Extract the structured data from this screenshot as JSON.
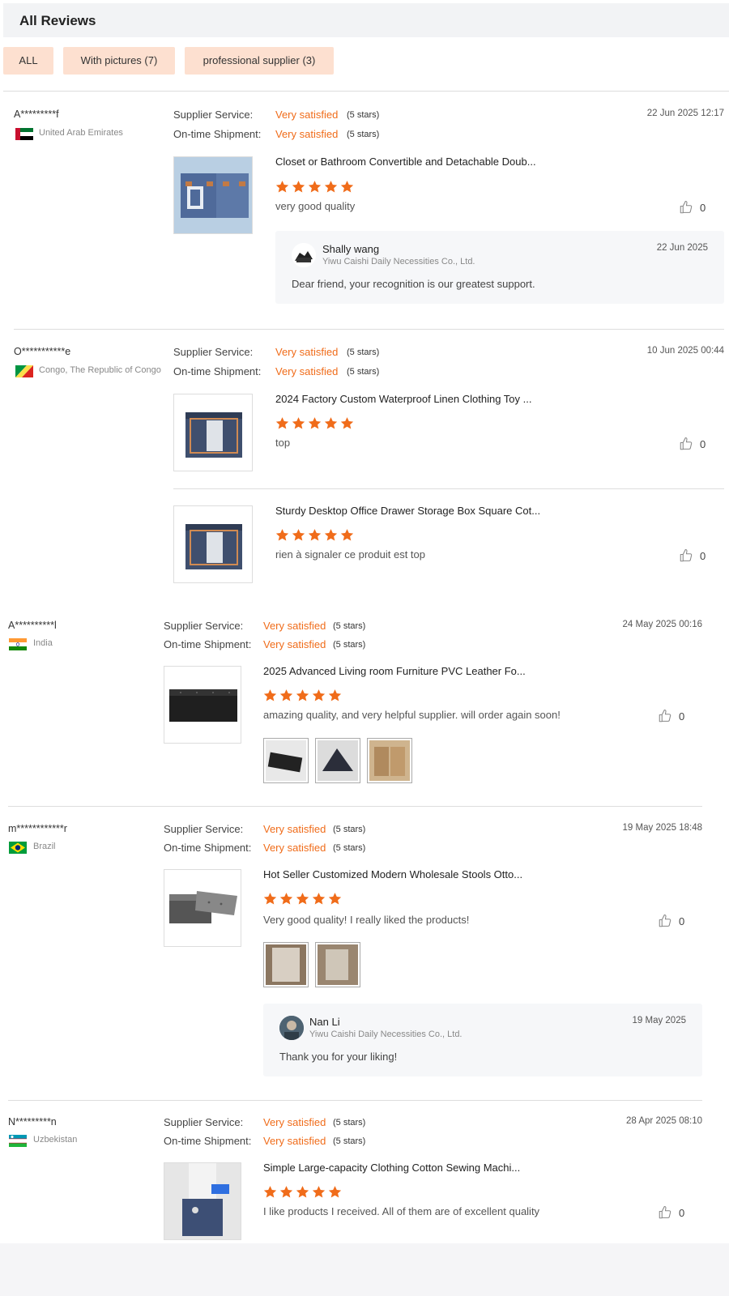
{
  "header": {
    "title": "All Reviews"
  },
  "filters": [
    {
      "label": "ALL"
    },
    {
      "label": "With pictures (7)"
    },
    {
      "label": "professional supplier (3)"
    }
  ],
  "labels": {
    "supplier_service": "Supplier Service:",
    "ontime_shipment": "On-time Shipment:"
  },
  "colors": {
    "accent": "#f06c1a",
    "filter_bg": "#fde0d0",
    "reply_bg": "#f6f7f9"
  },
  "reviews": [
    {
      "name": "A*********f",
      "country": "United Arab Emirates",
      "flag_icon": "uae-flag-icon",
      "date": "22 Jun 2025 12:17",
      "supplier_service": "Very satisfied",
      "supplier_service_stars": "(5 stars)",
      "ontime_shipment": "Very satisfied",
      "ontime_shipment_stars": "(5 stars)",
      "items": [
        {
          "product": "Closet or Bathroom Convertible and Detachable Doub...",
          "rating": 5,
          "comment": "very good quality",
          "likes": "0"
        }
      ],
      "reply": {
        "name": "Shally wang",
        "company": "Yiwu Caishi Daily Necessities Co., Ltd.",
        "date": "22 Jun 2025",
        "text": "Dear friend, your recognition is our greatest support."
      }
    },
    {
      "name": "O***********e",
      "country": "Congo, The Republic of Congo",
      "flag_icon": "congo-flag-icon",
      "date": "10 Jun 2025 00:44",
      "supplier_service": "Very satisfied",
      "supplier_service_stars": "(5 stars)",
      "ontime_shipment": "Very satisfied",
      "ontime_shipment_stars": "(5 stars)",
      "items": [
        {
          "product": "2024 Factory Custom Waterproof Linen Clothing Toy ...",
          "rating": 5,
          "comment": "top",
          "likes": "0"
        },
        {
          "product": "Sturdy Desktop Office Drawer Storage Box Square Cot...",
          "rating": 5,
          "comment": "rien à signaler ce produit est top",
          "likes": "0"
        }
      ]
    },
    {
      "name": "A**********l",
      "country": "India",
      "flag_icon": "india-flag-icon",
      "date": "24 May 2025 00:16",
      "supplier_service": "Very satisfied",
      "supplier_service_stars": "(5 stars)",
      "ontime_shipment": "Very satisfied",
      "ontime_shipment_stars": "(5 stars)",
      "items": [
        {
          "product": "2025 Advanced Living room Furniture PVC Leather Fo...",
          "rating": 5,
          "comment": "amazing quality, and very helpful supplier. will order again soon!",
          "likes": "0"
        }
      ]
    },
    {
      "name": "m************r",
      "country": "Brazil",
      "flag_icon": "brazil-flag-icon",
      "date": "19 May 2025 18:48",
      "supplier_service": "Very satisfied",
      "supplier_service_stars": "(5 stars)",
      "ontime_shipment": "Very satisfied",
      "ontime_shipment_stars": "(5 stars)",
      "items": [
        {
          "product": "Hot Seller Customized Modern Wholesale Stools Otto...",
          "rating": 5,
          "comment": "Very good quality! I really liked the products!",
          "likes": "0"
        }
      ],
      "reply": {
        "name": "Nan Li",
        "company": "Yiwu Caishi Daily Necessities Co., Ltd.",
        "date": "19 May 2025",
        "text": "Thank you for your liking!"
      }
    },
    {
      "name": "N*********n",
      "country": "Uzbekistan",
      "flag_icon": "uzbekistan-flag-icon",
      "date": "28 Apr 2025 08:10",
      "supplier_service": "Very satisfied",
      "supplier_service_stars": "(5 stars)",
      "ontime_shipment": "Very satisfied",
      "ontime_shipment_stars": "(5 stars)",
      "items": [
        {
          "product": "Simple Large-capacity Clothing Cotton Sewing Machi...",
          "rating": 5,
          "comment": "I like products I received. All of them are of excellent quality",
          "likes": "0"
        }
      ]
    }
  ]
}
